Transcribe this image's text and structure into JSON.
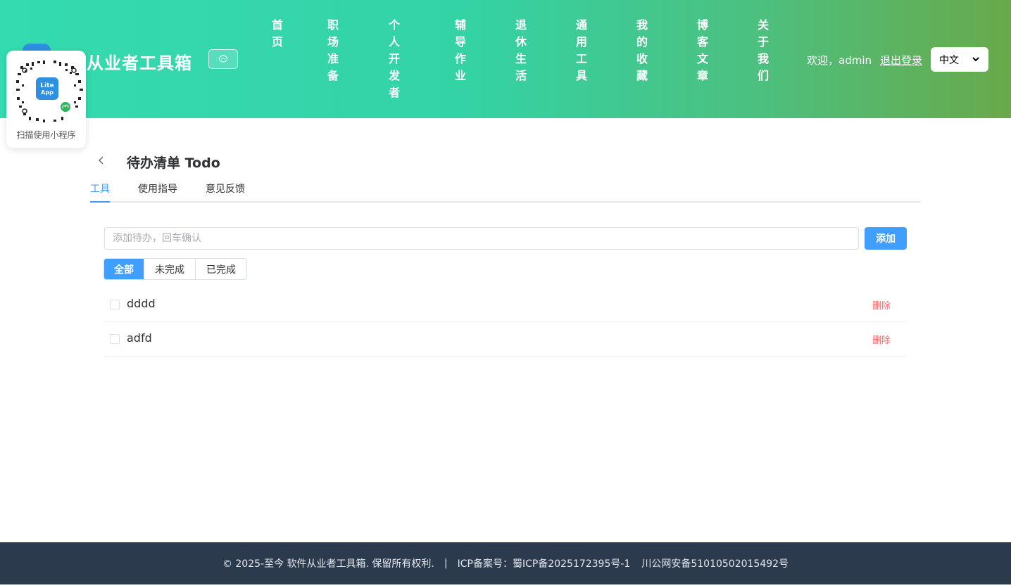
{
  "header": {
    "site_title": "件从业者工具箱",
    "nav": [
      "首页",
      "职场准备",
      "个人开发者",
      "辅导作业",
      "退休生活",
      "通用工具",
      "我的收藏",
      "博客文章",
      "关于我们"
    ],
    "welcome": "欢迎，admin",
    "logout": "退出登录",
    "language": "中文"
  },
  "qr": {
    "caption": "扫描使用小程序",
    "app_label_1": "Lite",
    "app_label_2": "App"
  },
  "page": {
    "title": "待办清单 Todo",
    "tabs": [
      "工具",
      "使用指导",
      "意见反馈"
    ],
    "active_tab": "工具"
  },
  "todo": {
    "placeholder": "添加待办，回车确认",
    "add_label": "添加",
    "filters": [
      "全部",
      "未完成",
      "已完成"
    ],
    "active_filter": "全部",
    "delete_label": "删除",
    "items": [
      {
        "text": "dddd",
        "done": false
      },
      {
        "text": "adfd",
        "done": false
      }
    ]
  },
  "footer": {
    "copyright": "© 2025-至今 软件从业者工具箱. 保留所有权利.",
    "separator": "|",
    "icp": "ICP备案号：蜀ICP备2025172395号-1",
    "police": "川公网安备51010502015492号"
  },
  "colors": {
    "accent": "#409eff",
    "danger": "#f56c6c",
    "header_start": "#34dbb0",
    "header_end": "#69a94a",
    "footer_bg": "#2c3a4e"
  }
}
